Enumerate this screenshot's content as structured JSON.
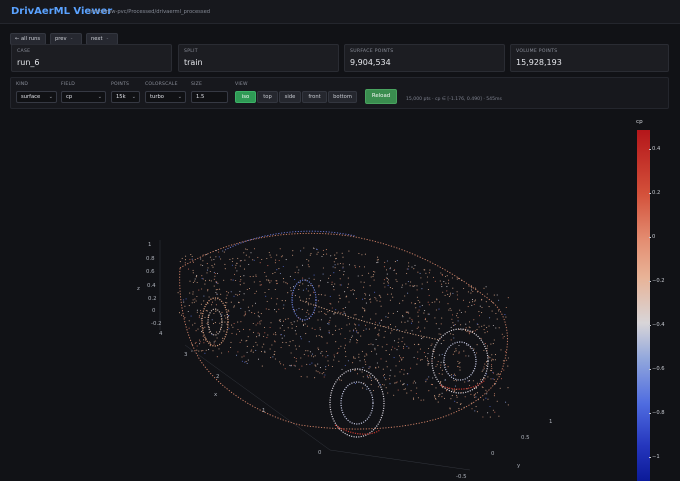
{
  "app": {
    "title": "DrivAerML Viewer",
    "path": "/mnt/nmw-pvc/Processed/drivaerml_processed"
  },
  "nav": {
    "all_runs": "← all runs",
    "prev": "prev",
    "next": "next",
    "sep": "-"
  },
  "info": [
    {
      "label": "CASE",
      "value": "run_6"
    },
    {
      "label": "SPLIT",
      "value": "train"
    },
    {
      "label": "SURFACE POINTS",
      "value": "9,904,534"
    },
    {
      "label": "VOLUME POINTS",
      "value": "15,928,193"
    }
  ],
  "controls": {
    "kind": {
      "label": "KIND",
      "value": "surface"
    },
    "field": {
      "label": "FIELD",
      "value": "cp"
    },
    "points": {
      "label": "POINTS",
      "value": "15k"
    },
    "colorscale": {
      "label": "COLORSCALE",
      "value": "turbo"
    },
    "size": {
      "label": "SIZE",
      "value": "1.5"
    },
    "view": {
      "label": "VIEW",
      "options": [
        "iso",
        "top",
        "side",
        "front",
        "bottom"
      ],
      "active": "iso"
    },
    "reload": "Reload",
    "stats": "15,000 pts · cp ∈ [-1.176, 0.490] · 545ms"
  },
  "plot": {
    "z_axis": {
      "label": "z",
      "ticks": [
        "1",
        "0.8",
        "0.6",
        "0.4",
        "0.2",
        "0",
        "-0.2"
      ]
    },
    "x_axis": {
      "label": "x",
      "ticks": [
        "4",
        "3",
        "2",
        "1",
        "0"
      ]
    },
    "y_axis": {
      "label": "y",
      "ticks": [
        "1",
        "0.5",
        "0",
        "-0.5"
      ]
    },
    "colorbar": {
      "title": "cp",
      "ticks": [
        "0.4",
        "0.2",
        "0",
        "−0.2",
        "−0.4",
        "−0.6",
        "−0.8",
        "−1"
      ]
    }
  }
}
